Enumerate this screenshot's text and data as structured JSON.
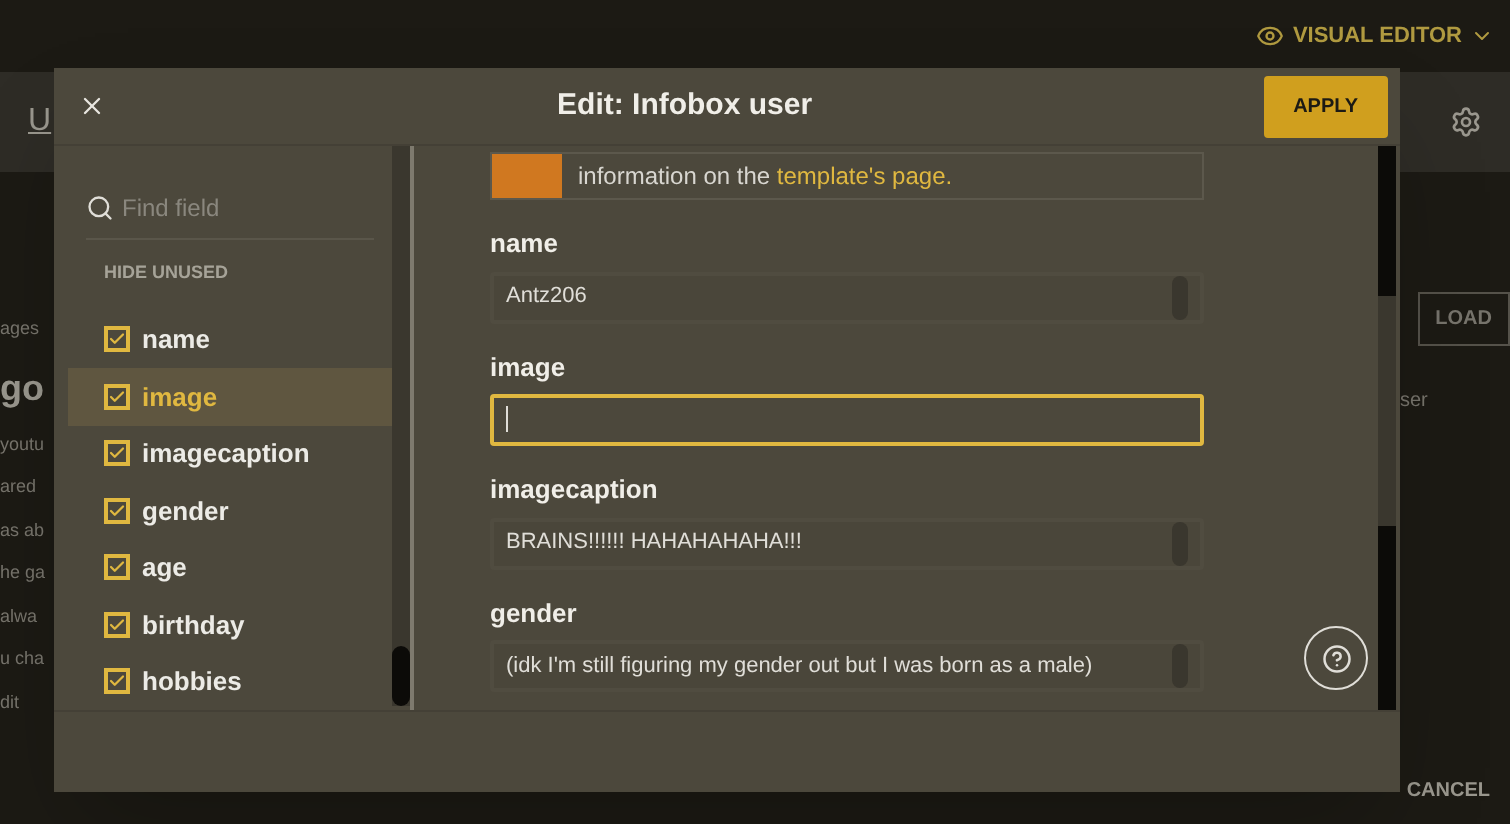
{
  "page": {
    "mode_menu": "VISUAL EDITOR",
    "tab": "U",
    "left_fragments": [
      "ages",
      "go",
      "youtu",
      "ared",
      "as ab",
      "he ga",
      "alwa",
      "u cha",
      "dit"
    ],
    "load_button": "LOAD",
    "right_fragment": "ser",
    "cancel": "CANCEL"
  },
  "dialog": {
    "title": "Edit: Infobox user",
    "apply": "APPLY",
    "search": {
      "placeholder": "Find field"
    },
    "hide_unused": "HIDE UNUSED",
    "params": [
      {
        "label": "name",
        "checked": true,
        "selected": false
      },
      {
        "label": "image",
        "checked": true,
        "selected": true
      },
      {
        "label": "imagecaption",
        "checked": true,
        "selected": false
      },
      {
        "label": "gender",
        "checked": true,
        "selected": false
      },
      {
        "label": "age",
        "checked": true,
        "selected": false
      },
      {
        "label": "birthday",
        "checked": true,
        "selected": false
      },
      {
        "label": "hobbies",
        "checked": true,
        "selected": false
      }
    ],
    "notice": {
      "text": "information on the ",
      "link": "template's page."
    },
    "fields": [
      {
        "label": "name",
        "value": "Antz206",
        "focused": false
      },
      {
        "label": "image",
        "focused": true
      },
      {
        "label": "imagecaption",
        "value": "BRAINS!!!!!! HAHAHAHAHA!!!",
        "focused": false
      },
      {
        "label": "gender",
        "value": "(idk I'm still figuring my gender out but I was born as a male)",
        "focused": false
      }
    ]
  }
}
